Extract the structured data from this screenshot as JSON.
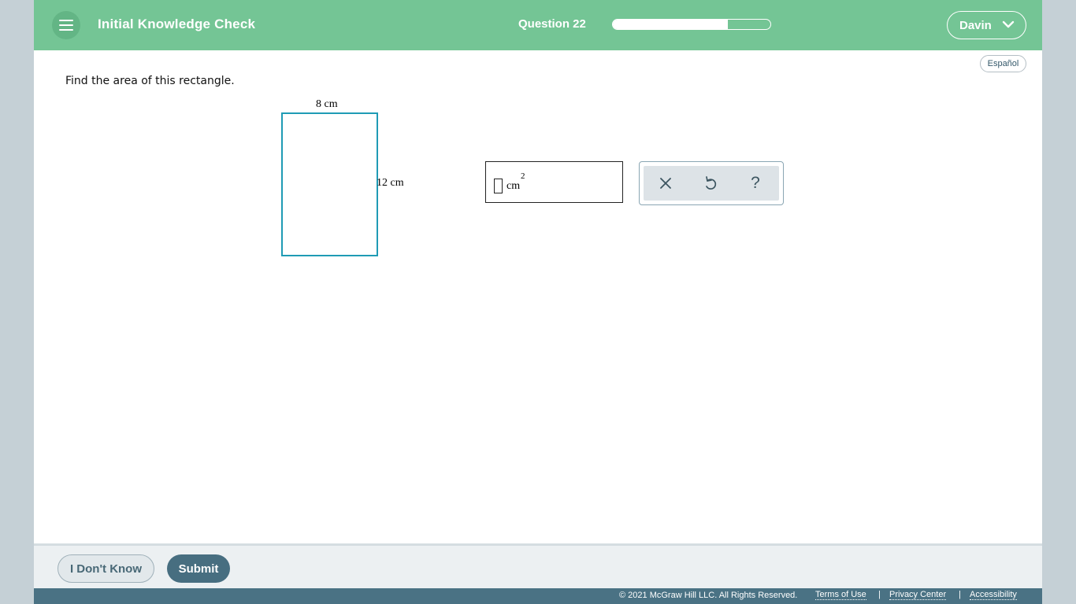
{
  "header": {
    "title": "Initial Knowledge Check",
    "question_label": "Question 22",
    "progress_fraction": 0.73,
    "user_name": "Davin",
    "menu_icon": "hamburger-icon",
    "dropdown_icon": "chevron-down-icon"
  },
  "content": {
    "language_button": "Español",
    "prompt": "Find the area of this rectangle.",
    "figure": {
      "width_label": "8 cm",
      "height_label": "12 cm",
      "rect_color": "#1f9bb5"
    },
    "answer": {
      "value": "",
      "unit": "cm",
      "unit_exponent": "2"
    },
    "tools": {
      "clear_icon": "close-icon",
      "undo_icon": "undo-icon",
      "help_label": "?"
    }
  },
  "actions": {
    "dont_know": "I Don't Know",
    "submit": "Submit"
  },
  "footer": {
    "copyright": "© 2021 McGraw Hill LLC. All Rights Reserved.",
    "terms": "Terms of Use",
    "privacy": "Privacy Center",
    "accessibility": "Accessibility",
    "separator": "|"
  },
  "colors": {
    "header_bg": "#74c595",
    "submit_bg": "#476e80",
    "footer_bg": "#4a7284"
  }
}
